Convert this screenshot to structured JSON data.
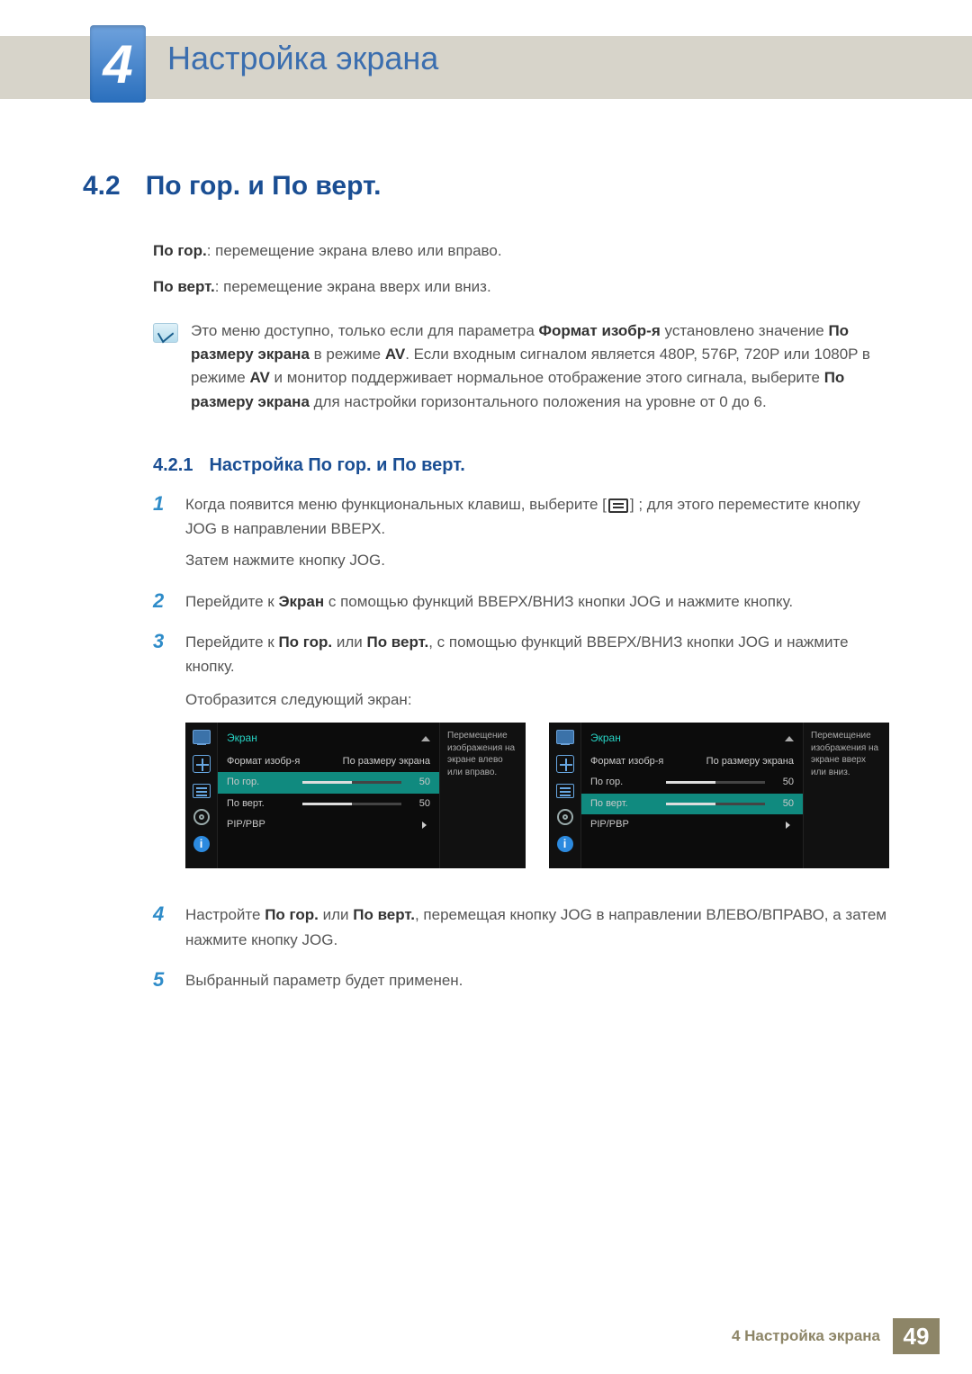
{
  "chapter": {
    "num": "4",
    "title": "Настройка экрана"
  },
  "section": {
    "num": "4.2",
    "title": "По гор. и По верт."
  },
  "desc": {
    "hpos_b": "По гор.",
    "hpos_t": ": перемещение экрана влево или вправо.",
    "vpos_b": "По верт.",
    "vpos_t": ": перемещение экрана вверх или вниз."
  },
  "note": {
    "l1a": "Это меню доступно, только если для параметра ",
    "l1b": "Формат изобр-я",
    "l1c": " установлено значение ",
    "l2a": "По размеру экрана",
    "l2b": " в режиме ",
    "l2c": "AV",
    "l2d": ". Если входным сигналом является 480P, 576P, 720P или 1080P в режиме ",
    "l2e": "AV",
    "l2f": " и монитор поддерживает нормальное отображение этого сигнала, выберите ",
    "l3a": "По размеру экрана",
    "l3b": " для настройки горизонтального положения на уровне от 0 до 6."
  },
  "subsection": {
    "num": "4.2.1",
    "title": "Настройка По гор. и По верт."
  },
  "steps": {
    "s1a": "Когда появится меню функциональных клавиш, выберите [",
    "s1b": "] ; для этого переместите кнопку JOG в направлении ВВЕРХ.",
    "s1c": "Затем нажмите кнопку JOG.",
    "s2a": "Перейдите к ",
    "s2b": "Экран",
    "s2c": " с помощью функций ВВЕРХ/ВНИЗ кнопки JOG и нажмите кнопку.",
    "s3a": "Перейдите к ",
    "s3b": "По гор.",
    "s3c": " или ",
    "s3d": "По верт.",
    "s3e": ", с помощью функций ВВЕРХ/ВНИЗ кнопки JOG и нажмите кнопку.",
    "s3f": "Отобразится следующий экран:",
    "s4a": "Настройте ",
    "s4b": "По гор.",
    "s4c": " или ",
    "s4d": "По верт.",
    "s4e": ", перемещая кнопку JOG в направлении ВЛЕВО/ВПРАВО, а затем нажмите кнопку JOG.",
    "s5": "Выбранный параметр будет применен."
  },
  "osd": {
    "header": "Экран",
    "rows": {
      "format_label": "Формат изобр-я",
      "format_value": "По размеру экрана",
      "hpos": "По гор.",
      "vpos": "По верт.",
      "pip": "PIP/PBP",
      "val50": "50"
    },
    "desc_h": "Перемещение изображения на экране влево или вправо.",
    "desc_v": "Перемещение изображения на экране вверх или вниз."
  },
  "footer": {
    "text": "4 Настройка экрана",
    "page": "49"
  }
}
